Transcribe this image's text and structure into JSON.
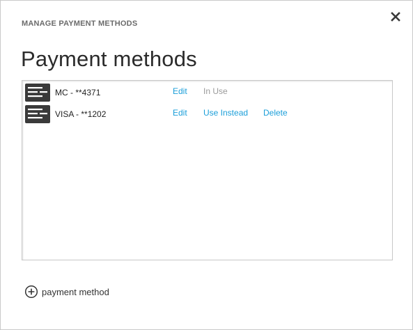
{
  "dialog": {
    "label": "MANAGE PAYMENT METHODS",
    "close_icon": "close-icon",
    "title": "Payment methods"
  },
  "payment_methods": [
    {
      "name": "MC - **4371",
      "icon": "credit-card-icon",
      "edit_label": "Edit",
      "status_label": "In Use"
    },
    {
      "name": "VISA - **1202",
      "icon": "credit-card-icon",
      "edit_label": "Edit",
      "use_label": "Use Instead",
      "delete_label": "Delete"
    }
  ],
  "add_payment": {
    "icon": "plus-circle-icon",
    "label": "payment method"
  },
  "colors": {
    "link": "#1a9ed9",
    "muted": "#9a9a9a",
    "card_icon": "#3a3a3a"
  }
}
